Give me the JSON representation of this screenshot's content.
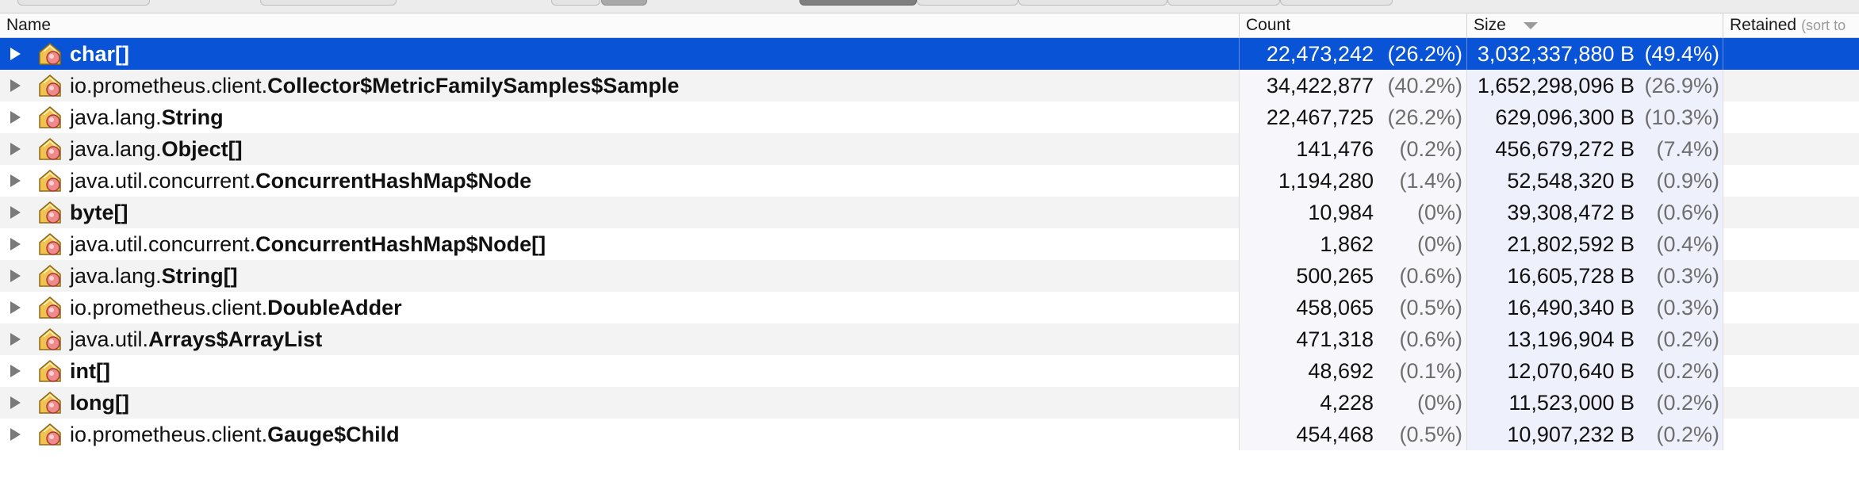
{
  "columns": {
    "name": "Name",
    "count": "Count",
    "size": "Size",
    "retained": "Retained",
    "retained_hint": "(sort to"
  },
  "rows": [
    {
      "pkg": "",
      "cls": "char[]",
      "count": "22,473,242",
      "count_pct": "(26.2%)",
      "size": "3,032,337,880 B",
      "size_pct": "(49.4%)",
      "selected": true
    },
    {
      "pkg": "io.prometheus.client.",
      "cls": "Collector$MetricFamilySamples$Sample",
      "count": "34,422,877",
      "count_pct": "(40.2%)",
      "size": "1,652,298,096 B",
      "size_pct": "(26.9%)"
    },
    {
      "pkg": "java.lang.",
      "cls": "String",
      "count": "22,467,725",
      "count_pct": "(26.2%)",
      "size": "629,096,300 B",
      "size_pct": "(10.3%)"
    },
    {
      "pkg": "java.lang.",
      "cls": "Object[]",
      "count": "141,476",
      "count_pct": "(0.2%)",
      "size": "456,679,272 B",
      "size_pct": "(7.4%)"
    },
    {
      "pkg": "java.util.concurrent.",
      "cls": "ConcurrentHashMap$Node",
      "count": "1,194,280",
      "count_pct": "(1.4%)",
      "size": "52,548,320 B",
      "size_pct": "(0.9%)"
    },
    {
      "pkg": "",
      "cls": "byte[]",
      "count": "10,984",
      "count_pct": "(0%)",
      "size": "39,308,472 B",
      "size_pct": "(0.6%)"
    },
    {
      "pkg": "java.util.concurrent.",
      "cls": "ConcurrentHashMap$Node[]",
      "count": "1,862",
      "count_pct": "(0%)",
      "size": "21,802,592 B",
      "size_pct": "(0.4%)"
    },
    {
      "pkg": "java.lang.",
      "cls": "String[]",
      "count": "500,265",
      "count_pct": "(0.6%)",
      "size": "16,605,728 B",
      "size_pct": "(0.3%)"
    },
    {
      "pkg": "io.prometheus.client.",
      "cls": "DoubleAdder",
      "count": "458,065",
      "count_pct": "(0.5%)",
      "size": "16,490,340 B",
      "size_pct": "(0.3%)"
    },
    {
      "pkg": "java.util.",
      "cls": "Arrays$ArrayList",
      "count": "471,318",
      "count_pct": "(0.6%)",
      "size": "13,196,904 B",
      "size_pct": "(0.2%)"
    },
    {
      "pkg": "",
      "cls": "int[]",
      "count": "48,692",
      "count_pct": "(0.1%)",
      "size": "12,070,640 B",
      "size_pct": "(0.2%)"
    },
    {
      "pkg": "",
      "cls": "long[]",
      "count": "4,228",
      "count_pct": "(0%)",
      "size": "11,523,000 B",
      "size_pct": "(0.2%)"
    },
    {
      "pkg": "io.prometheus.client.",
      "cls": "Gauge$Child",
      "count": "454,468",
      "count_pct": "(0.5%)",
      "size": "10,907,232 B",
      "size_pct": "(0.2%)"
    }
  ],
  "icons": {
    "row_icon": "class-icon",
    "expand": "expand-arrow-icon",
    "sort": "sort-descending-icon"
  },
  "colors": {
    "selection": "#0953d6",
    "header_bg": "#fbfbfb",
    "stripe": "#f3f3f3"
  }
}
